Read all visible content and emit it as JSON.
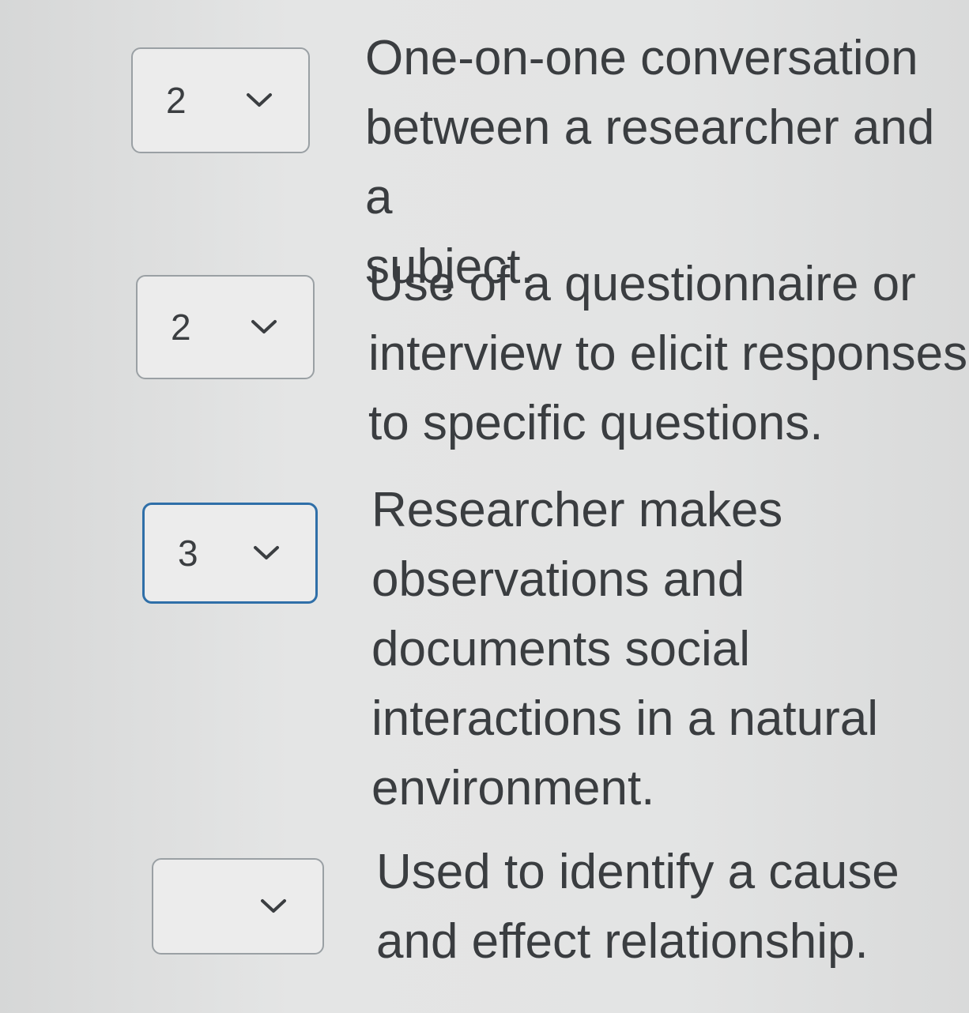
{
  "matching_items": [
    {
      "selected_value": "2",
      "description_lines": [
        "One-on-one conversation",
        "between a researcher and a",
        "subject."
      ]
    },
    {
      "selected_value": "2",
      "description_lines": [
        "Use of a questionnaire or",
        "interview to elicit responses",
        "to specific questions."
      ]
    },
    {
      "selected_value": "3",
      "description_lines": [
        "Researcher makes",
        "observations and",
        "documents social",
        "interactions in a natural",
        "environment."
      ]
    },
    {
      "selected_value": "",
      "description_lines": [
        "Used to identify a cause",
        "and effect relationship."
      ]
    }
  ],
  "icons": {
    "dropdown": "chevron-down-icon"
  },
  "colors": {
    "background": "#e2e3e3",
    "text": "#3a3d40",
    "select_border": "#9aa0a4",
    "focus_border": "#2f6fa8"
  }
}
